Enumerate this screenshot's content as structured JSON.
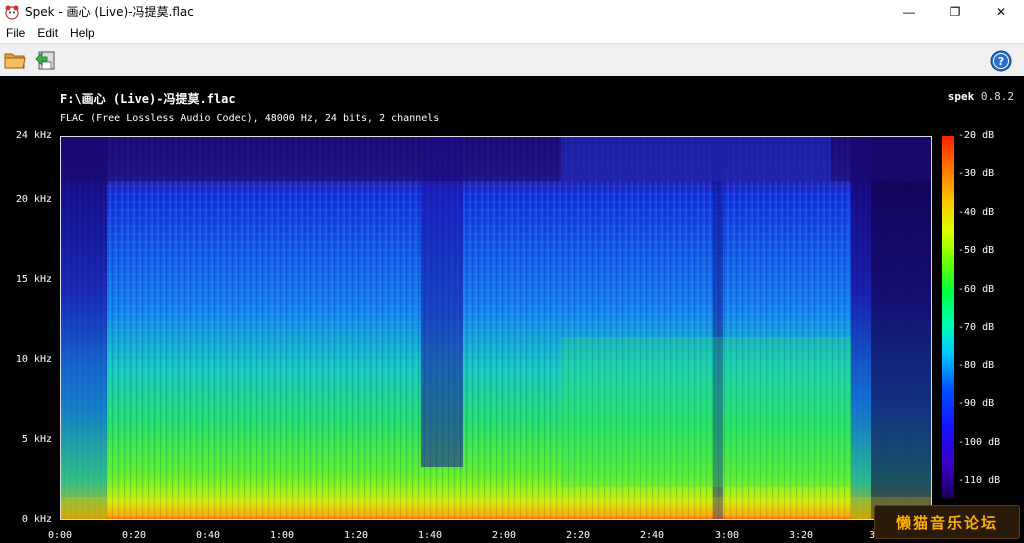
{
  "window": {
    "title": "Spek - 画心 (Live)-冯提莫.flac",
    "minimize": "—",
    "maximize": "❐",
    "close": "✕"
  },
  "menu": {
    "items": [
      "File",
      "Edit",
      "Help"
    ]
  },
  "toolbar": {
    "open_icon": "folder-open-icon",
    "save_icon": "save-image-icon",
    "help_icon": "help-icon"
  },
  "spectrogram": {
    "filename": "F:\\画心 (Live)-冯提莫.flac",
    "info": "FLAC (Free Lossless Audio Codec), 48000 Hz, 24 bits, 2 channels",
    "brand_name": "spek",
    "brand_version": "0.8.2",
    "freq_labels": [
      "24 kHz",
      "20 kHz",
      "15 kHz",
      "10 kHz",
      "5 kHz",
      "0 kHz"
    ],
    "time_labels": [
      "0:00",
      "0:20",
      "0:40",
      "1:00",
      "1:20",
      "1:40",
      "2:00",
      "2:20",
      "2:40",
      "3:00",
      "3:20",
      "3:"
    ],
    "db_labels": [
      "-20 dB",
      "-30 dB",
      "-40 dB",
      "-50 dB",
      "-60 dB",
      "-70 dB",
      "-80 dB",
      "-90 dB",
      "-100 dB",
      "-110 dB"
    ],
    "colors": {
      "low": "#1a0060",
      "mid_low": "#1414ff",
      "mid": "#00c8ff",
      "mid_high": "#00ff3c",
      "high": "#ffc400",
      "peak": "#ff1e00"
    }
  },
  "watermark": {
    "text": "懒猫音乐论坛"
  }
}
